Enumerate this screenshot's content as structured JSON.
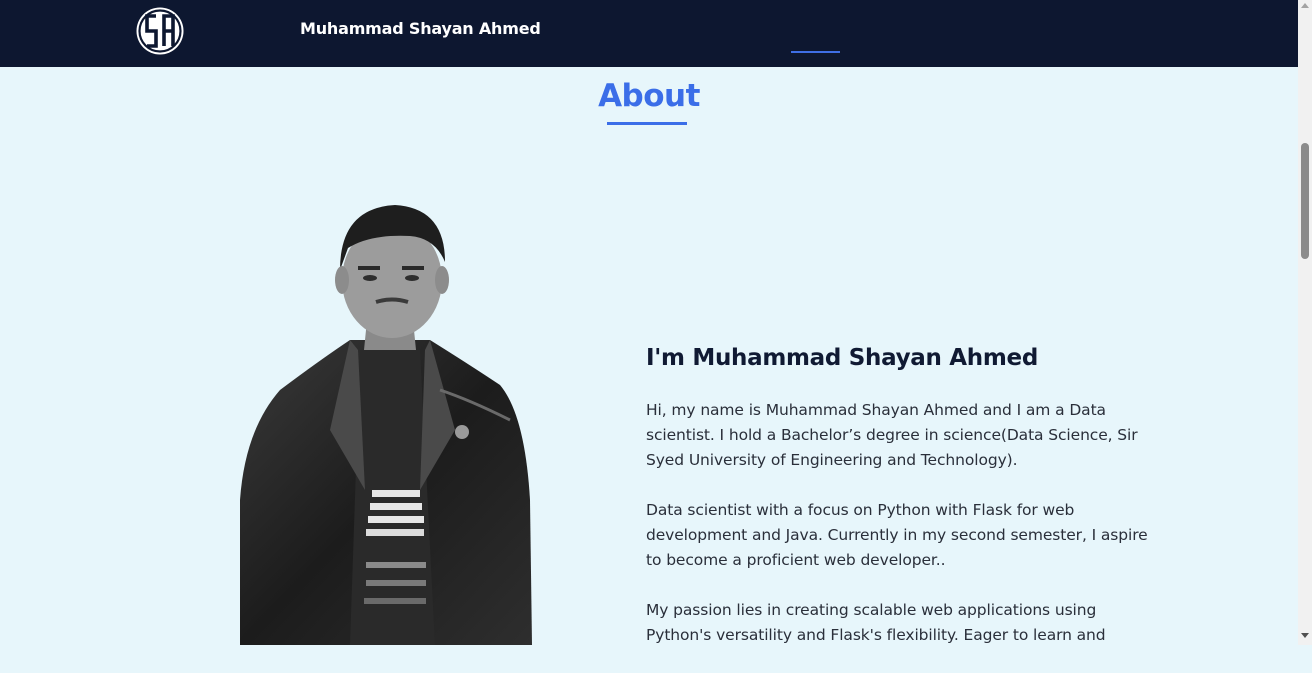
{
  "navbar": {
    "brand": "Muhammad Shayan Ahmed",
    "logo_icon": "sa-monogram-logo",
    "active_indicator_color": "#3f6fe6"
  },
  "about": {
    "title": "About",
    "heading": "I'm Muhammad Shayan Ahmed",
    "paragraphs": [
      "Hi, my name is Muhammad Shayan Ahmed and I am a Data scientist. I hold a Bachelor’s degree in science(Data Science, Sir Syed University of Engineering and Technology).",
      "Data scientist with a focus on Python with Flask for web development and Java. Currently in my second semester, I aspire to become a proficient web developer..",
      "My passion lies in creating scalable web applications using Python's versatility and Flask's flexibility. Eager to learn and"
    ]
  },
  "colors": {
    "nav_background": "#0d1730",
    "page_background": "#e7f6fb",
    "accent": "#3b6ee8",
    "heading_text": "#101a33",
    "body_text": "#2a2f3a"
  }
}
